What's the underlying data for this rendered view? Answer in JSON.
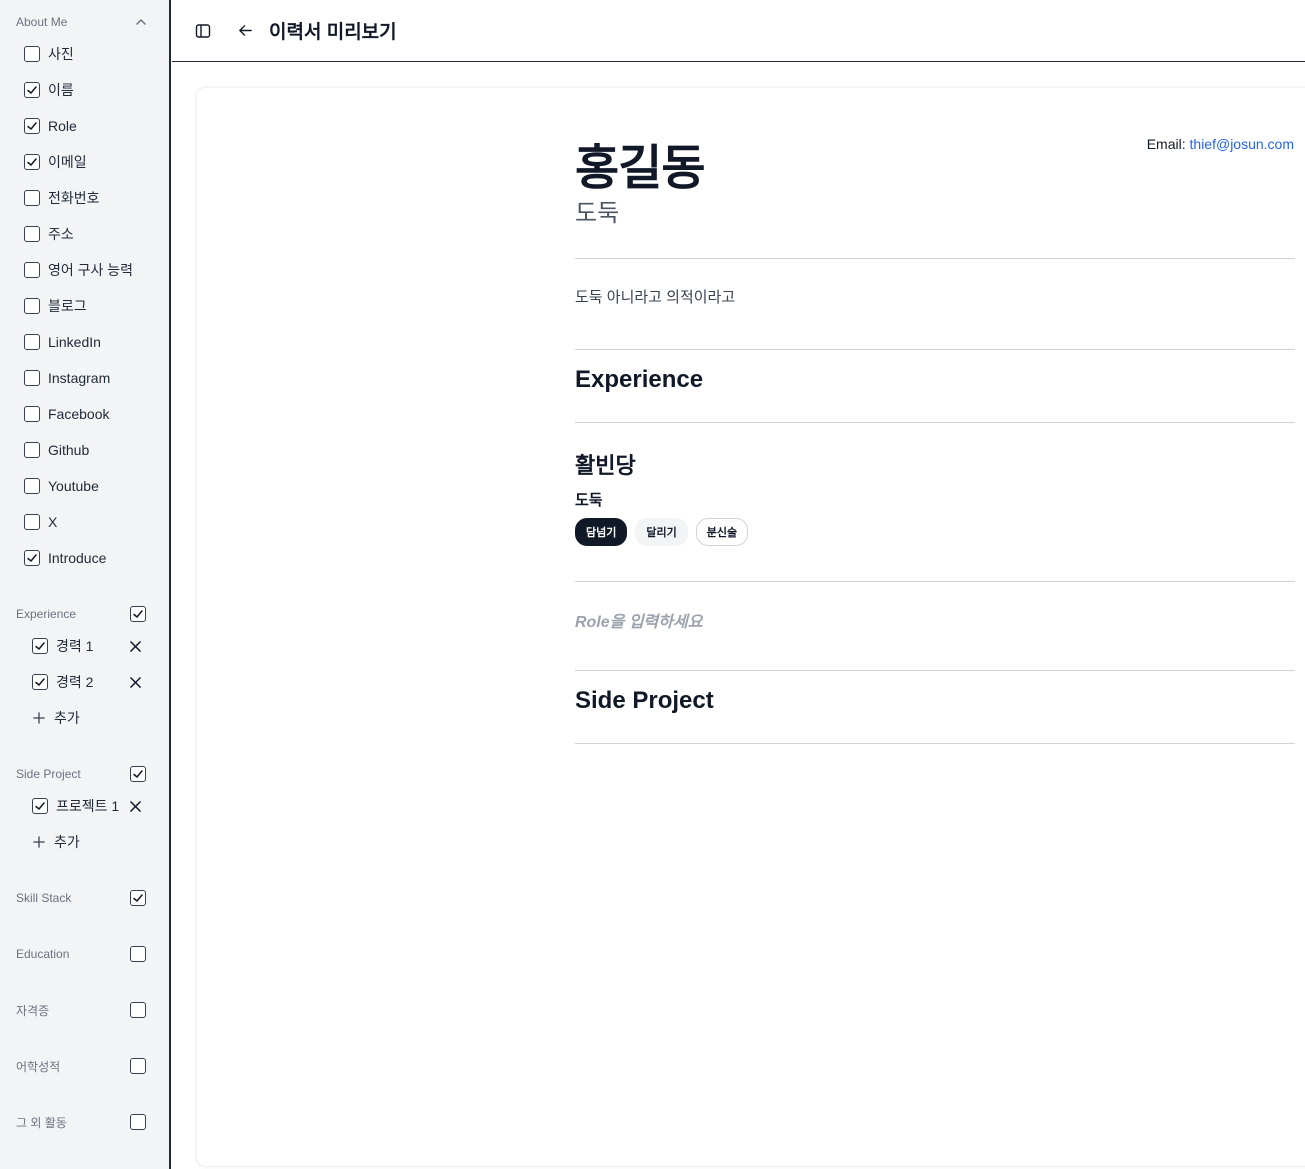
{
  "sidebar": {
    "about_me": {
      "title": "About Me",
      "items": [
        {
          "label": "사진",
          "checked": false
        },
        {
          "label": "이름",
          "checked": true
        },
        {
          "label": "Role",
          "checked": true
        },
        {
          "label": "이메일",
          "checked": true
        },
        {
          "label": "전화번호",
          "checked": false
        },
        {
          "label": "주소",
          "checked": false
        },
        {
          "label": "영어 구사 능력",
          "checked": false
        },
        {
          "label": "블로그",
          "checked": false
        },
        {
          "label": "LinkedIn",
          "checked": false
        },
        {
          "label": "Instagram",
          "checked": false
        },
        {
          "label": "Facebook",
          "checked": false
        },
        {
          "label": "Github",
          "checked": false
        },
        {
          "label": "Youtube",
          "checked": false
        },
        {
          "label": "X",
          "checked": false
        },
        {
          "label": "Introduce",
          "checked": true
        }
      ]
    },
    "experience": {
      "title": "Experience",
      "checked": true,
      "items": [
        {
          "label": "경력 1",
          "checked": true
        },
        {
          "label": "경력 2",
          "checked": true
        }
      ],
      "add_label": "추가"
    },
    "side_project": {
      "title": "Side Project",
      "checked": true,
      "items": [
        {
          "label": "프로젝트 1",
          "checked": true
        }
      ],
      "add_label": "추가"
    },
    "skill_stack": {
      "title": "Skill Stack",
      "checked": true
    },
    "education": {
      "title": "Education",
      "checked": false
    },
    "certificates": {
      "title": "자격증",
      "checked": false
    },
    "language_scores": {
      "title": "어학성적",
      "checked": false
    },
    "other_activities": {
      "title": "그 외 활동",
      "checked": false
    }
  },
  "topbar": {
    "title": "이력서 미리보기"
  },
  "resume": {
    "name": "홍길동",
    "role": "도둑",
    "email_label": "Email:",
    "email": "thief@josun.com",
    "introduce": "도둑 아니라고 의적이라고",
    "experience_heading": "Experience",
    "company": "활빈당",
    "job_title": "도둑",
    "tags": [
      "담넘기",
      "달리기",
      "분신술"
    ],
    "role_placeholder": "Role을 입력하세요",
    "side_project_heading": "Side Project"
  }
}
